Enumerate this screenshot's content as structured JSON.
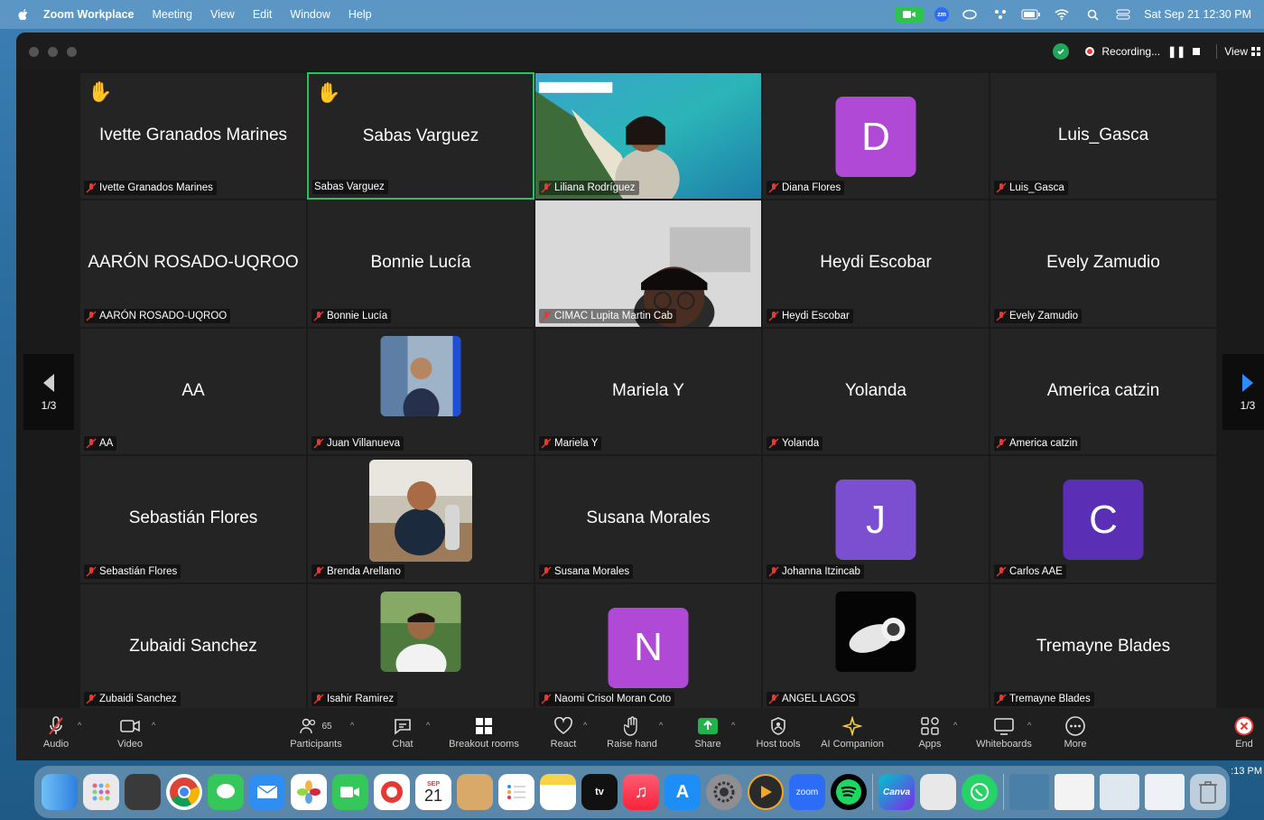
{
  "menubar": {
    "app_name": "Zoom Workplace",
    "items": [
      "Meeting",
      "View",
      "Edit",
      "Window",
      "Help"
    ],
    "datetime": "Sat Sep 21  12:30 PM",
    "zm_text": "zm"
  },
  "window": {
    "recording_label": "Recording...",
    "view_label": "View"
  },
  "pager": {
    "left": "1/3",
    "right": "1/3"
  },
  "tiles": [
    {
      "name": "Ivette Granados Marines",
      "label": "Ivette Granados Marines"
    },
    {
      "name": "Sabas Varguez",
      "label": "Sabas Varguez"
    },
    {
      "name": "",
      "label": "Liliana Rodríguez"
    },
    {
      "name": "",
      "label": "Diana Flores",
      "initial": "D"
    },
    {
      "name": "Luis_Gasca",
      "label": "Luis_Gasca"
    },
    {
      "name": "AARÓN ROSADO-UQROO",
      "label": "AARÓN ROSADO-UQROO"
    },
    {
      "name": "Bonnie Lucía",
      "label": "Bonnie Lucía"
    },
    {
      "name": "",
      "label": "CIMAC Lupita Martin Cab"
    },
    {
      "name": "Heydi Escobar",
      "label": "Heydi Escobar"
    },
    {
      "name": "Evely Zamudio",
      "label": "Evely Zamudio"
    },
    {
      "name": "AA",
      "label": "AA"
    },
    {
      "name": "",
      "label": "Juan Villanueva"
    },
    {
      "name": "Mariela Y",
      "label": "Mariela Y"
    },
    {
      "name": "Yolanda",
      "label": "Yolanda"
    },
    {
      "name": "America catzin",
      "label": "America catzin"
    },
    {
      "name": "Sebastián Flores",
      "label": "Sebastián Flores"
    },
    {
      "name": "",
      "label": "Brenda Arellano"
    },
    {
      "name": "Susana Morales",
      "label": "Susana Morales"
    },
    {
      "name": "",
      "label": "Johanna Itzincab",
      "initial": "J"
    },
    {
      "name": "",
      "label": "Carlos AAE",
      "initial": "C"
    },
    {
      "name": "Zubaidi Sanchez",
      "label": "Zubaidi Sanchez"
    },
    {
      "name": "",
      "label": "Isahir Ramirez"
    },
    {
      "name": "",
      "label": "Naomi Crisol Moran Coto",
      "initial": "N"
    },
    {
      "name": "",
      "label": "ANGEL LAGOS"
    },
    {
      "name": "Tremayne Blades",
      "label": "Tremayne Blades"
    }
  ],
  "toolbar": {
    "audio": "Audio",
    "video": "Video",
    "participants": "Participants",
    "participants_count": "65",
    "chat": "Chat",
    "breakout": "Breakout rooms",
    "react": "React",
    "raise_hand": "Raise hand",
    "share": "Share",
    "host_tools": "Host tools",
    "ai_companion": "AI Companion",
    "apps": "Apps",
    "whiteboards": "Whiteboards",
    "more": "More",
    "end": "End"
  },
  "dock": {
    "calendar_month": "SEP",
    "calendar_day": "21",
    "zoom": "zoom",
    "canva": "Canva",
    "tv": "tv"
  },
  "clock_fragment": ":13 PM",
  "colors": {
    "active_border": "#22c55e",
    "avatar_pink": "#b04ad6",
    "avatar_violet": "#7b4fd0",
    "avatar_indigo": "#5a2fb5",
    "end_red": "#e53935"
  }
}
